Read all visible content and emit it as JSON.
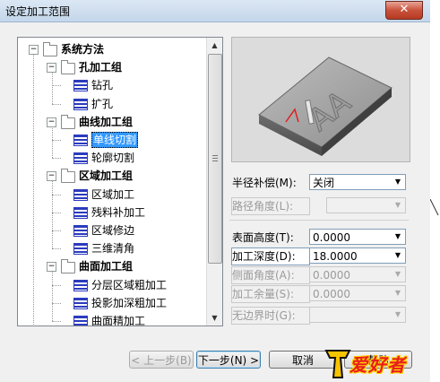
{
  "window": {
    "title": "设定加工范围",
    "close_glyph": "✕"
  },
  "tree": {
    "items": [
      {
        "label": "系统方法",
        "level": 0,
        "kind": "folder",
        "bold": true
      },
      {
        "label": "孔加工组",
        "level": 1,
        "kind": "folder",
        "bold": true
      },
      {
        "label": "钻孔",
        "level": 2,
        "kind": "op"
      },
      {
        "label": "扩孔",
        "level": 2,
        "kind": "op"
      },
      {
        "label": "曲线加工组",
        "level": 1,
        "kind": "folder",
        "bold": true
      },
      {
        "label": "单线切割",
        "level": 2,
        "kind": "op",
        "selected": true
      },
      {
        "label": "轮廓切割",
        "level": 2,
        "kind": "op"
      },
      {
        "label": "区域加工组",
        "level": 1,
        "kind": "folder",
        "bold": true
      },
      {
        "label": "区域加工",
        "level": 2,
        "kind": "op"
      },
      {
        "label": "残料补加工",
        "level": 2,
        "kind": "op"
      },
      {
        "label": "区域修边",
        "level": 2,
        "kind": "op"
      },
      {
        "label": "三维清角",
        "level": 2,
        "kind": "op"
      },
      {
        "label": "曲面加工组",
        "level": 1,
        "kind": "folder",
        "bold": true
      },
      {
        "label": "分层区域粗加工",
        "level": 2,
        "kind": "op"
      },
      {
        "label": "投影加深粗加工",
        "level": 2,
        "kind": "op"
      },
      {
        "label": "曲面精加工",
        "level": 2,
        "kind": "op"
      }
    ],
    "expander_glyph": "−"
  },
  "preview": {
    "engraving": "AA"
  },
  "form": {
    "radius_comp": {
      "label": "半径补偿(M):",
      "value": "关闭"
    },
    "path_angle": {
      "label": "路径角度(L):",
      "value": ""
    },
    "surface_height": {
      "label": "表面高度(T):",
      "value": "0.0000"
    },
    "depth": {
      "label": "加工深度(D):",
      "value": "18.0000"
    },
    "side_angle": {
      "label": "侧面角度(A):",
      "value": "0.0000"
    },
    "allowance": {
      "label": "加工余量(S):",
      "value": "0.0000"
    },
    "no_boundary": {
      "label": "无边界时(G):",
      "value": ""
    }
  },
  "buttons": {
    "prev": "< 上一步(B)",
    "next": "下一步(N) >",
    "cancel": "取消",
    "help": "帮助"
  },
  "watermark": {
    "text": "爱好者"
  },
  "colors": {
    "selection": "#3399ff",
    "tree_icon": "#2b3bbd"
  }
}
